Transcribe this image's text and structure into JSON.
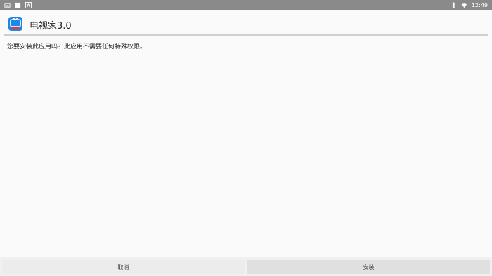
{
  "status_bar": {
    "time": "12:49",
    "left_icons": [
      "photo-icon",
      "square-icon",
      "a-icon"
    ],
    "right_icons": [
      "bluetooth-icon",
      "wifi-icon"
    ]
  },
  "app": {
    "name": "电视家3.0",
    "icon": "tv-app-icon",
    "accent_color": "#1e88e5"
  },
  "message": "您要安装此应用吗？此应用不需要任何特殊权限。",
  "buttons": {
    "cancel": "取消",
    "install": "安装"
  }
}
